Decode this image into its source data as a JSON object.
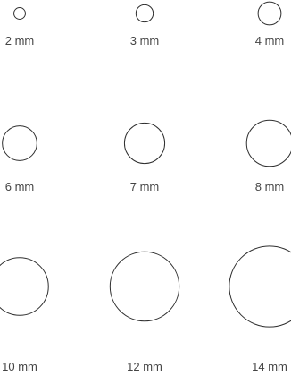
{
  "chart_data": {
    "type": "other",
    "unit": "mm",
    "sizes": [
      {
        "label": "2 mm",
        "value": 2
      },
      {
        "label": "3 mm",
        "value": 3
      },
      {
        "label": "4 mm",
        "value": 4
      },
      {
        "label": "6 mm",
        "value": 6
      },
      {
        "label": "7 mm",
        "value": 7
      },
      {
        "label": "8 mm",
        "value": 8
      },
      {
        "label": "10 mm",
        "value": 10
      },
      {
        "label": "12 mm",
        "value": 12
      },
      {
        "label": "14 mm",
        "value": 14
      }
    ]
  },
  "colors": {
    "circle_stroke": "#2f2f2f",
    "label_text": "#444444",
    "background": "#ffffff"
  }
}
